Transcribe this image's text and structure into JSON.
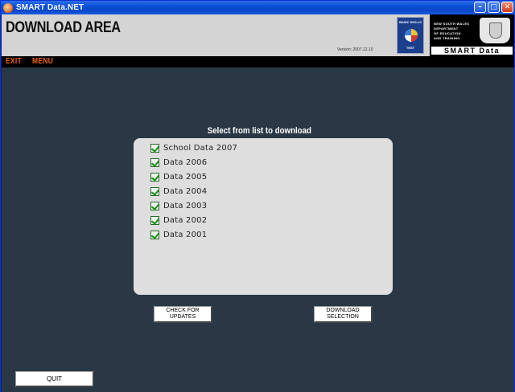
{
  "window": {
    "title": "SMART Data.NET"
  },
  "header": {
    "title": "DOWNLOAD AREA",
    "version": "Version: 2007.12.10",
    "bst_logo": {
      "line1": "BASIC SKILLS",
      "line2": "TEST"
    },
    "department": [
      "NEW SOUTH WALES",
      "DEPARTMENT",
      "OF EDUCATION",
      "AND TRAINING"
    ],
    "brand": "SMART Data"
  },
  "menu": {
    "exit_label": "EXIT",
    "menu_label": "MENU"
  },
  "main": {
    "heading": "Select from list to download",
    "items": [
      {
        "label": "School Data 2007",
        "checked": true
      },
      {
        "label": "Data 2006",
        "checked": true
      },
      {
        "label": "Data 2005",
        "checked": true
      },
      {
        "label": "Data 2004",
        "checked": true
      },
      {
        "label": "Data 2003",
        "checked": true
      },
      {
        "label": "Data 2002",
        "checked": true
      },
      {
        "label": "Data 2001",
        "checked": true
      }
    ],
    "check_updates": {
      "line1": "CHECK FOR",
      "line2": "UPDATES"
    },
    "download": {
      "line1": "DOWNLOAD",
      "line2": "SELECTION"
    },
    "quit_label": "QUIT"
  },
  "colors": {
    "background": "#2a3846",
    "menu_text": "#e8641a",
    "header_bg": "#d4d4d4",
    "list_bg": "#dedede",
    "checkmark": "#1b8a1b"
  }
}
